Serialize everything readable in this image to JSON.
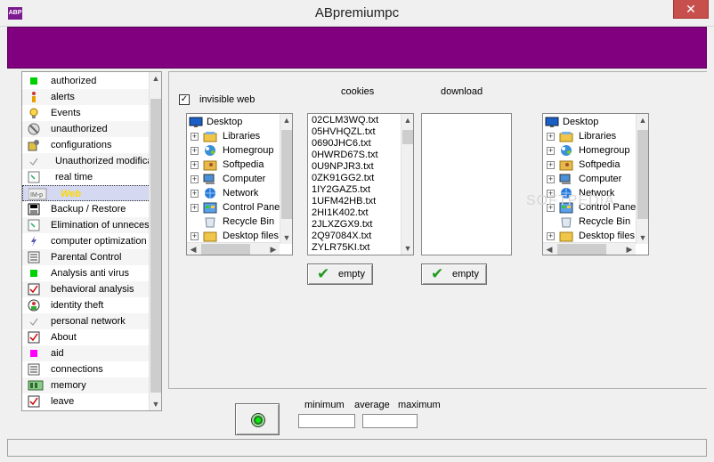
{
  "window": {
    "title": "ABpremiumpc",
    "app_icon_text": "ABP",
    "close_glyph": "✕"
  },
  "sidebar": {
    "items": [
      {
        "label": "authorized",
        "icon": "green-square-icon"
      },
      {
        "label": "alerts",
        "icon": "person-alert-icon"
      },
      {
        "label": "Events",
        "icon": "lightbulb-icon"
      },
      {
        "label": "unauthorized",
        "icon": "no-sign-icon"
      },
      {
        "label": "configurations",
        "icon": "config-icon"
      },
      {
        "label": "Unauthorized modifica",
        "icon": "small-check-icon"
      },
      {
        "label": "real time",
        "icon": "arrow-icon"
      },
      {
        "label": "Web",
        "icon": "web-icon",
        "icon_text": "IM-p"
      },
      {
        "label": "Backup / Restore",
        "icon": "backup-icon"
      },
      {
        "label": "Elimination of unneces",
        "icon": "arrow-icon"
      },
      {
        "label": "computer optimization",
        "icon": "lightning-icon"
      },
      {
        "label": "Parental Control",
        "icon": "list-icon"
      },
      {
        "label": "Analysis anti virus",
        "icon": "green-square-icon"
      },
      {
        "label": "behavioral analysis",
        "icon": "checkbox-icon"
      },
      {
        "label": "identity theft",
        "icon": "identity-icon"
      },
      {
        "label": "personal network",
        "icon": "small-check-icon"
      },
      {
        "label": "About",
        "icon": "checkbox-icon"
      },
      {
        "label": "aid",
        "icon": "magenta-square-icon"
      },
      {
        "label": "connections",
        "icon": "list-icon"
      },
      {
        "label": "memory",
        "icon": "memory-icon"
      },
      {
        "label": "leave",
        "icon": "checkbox-icon"
      }
    ]
  },
  "web_panel": {
    "invisible_web_label": "invisible web",
    "invisible_web_checked": true,
    "cookies_header": "cookies",
    "download_header": "download",
    "left_tree": [
      {
        "label": "Desktop",
        "icon": "desktop-icon",
        "expandable": false
      },
      {
        "label": "Libraries",
        "icon": "libraries-icon",
        "expandable": true
      },
      {
        "label": "Homegroup",
        "icon": "homegroup-icon",
        "expandable": true
      },
      {
        "label": "Softpedia",
        "icon": "user-folder-icon",
        "expandable": true
      },
      {
        "label": "Computer",
        "icon": "computer-icon",
        "expandable": true
      },
      {
        "label": "Network",
        "icon": "network-icon",
        "expandable": true
      },
      {
        "label": "Control Pane",
        "icon": "control-panel-icon",
        "expandable": true
      },
      {
        "label": "Recycle Bin",
        "icon": "recycle-bin-icon",
        "expandable": false
      },
      {
        "label": "Desktop files",
        "icon": "folder-icon",
        "expandable": true
      }
    ],
    "right_tree": [
      {
        "label": "Desktop",
        "icon": "desktop-icon",
        "expandable": false
      },
      {
        "label": "Libraries",
        "icon": "libraries-icon",
        "expandable": true
      },
      {
        "label": "Homegroup",
        "icon": "homegroup-icon",
        "expandable": true
      },
      {
        "label": "Softpedia",
        "icon": "user-folder-icon",
        "expandable": true
      },
      {
        "label": "Computer",
        "icon": "computer-icon",
        "expandable": true
      },
      {
        "label": "Network",
        "icon": "network-icon",
        "expandable": true
      },
      {
        "label": "Control Pane",
        "icon": "control-panel-icon",
        "expandable": true
      },
      {
        "label": "Recycle Bin",
        "icon": "recycle-bin-icon",
        "expandable": false
      },
      {
        "label": "Desktop files",
        "icon": "folder-icon",
        "expandable": true
      }
    ],
    "cookies": [
      "02CLM3WQ.txt",
      "05HVHQZL.txt",
      "0690JHC6.txt",
      "0HWRD67S.txt",
      "0U9NPJR3.txt",
      "0ZK91GG2.txt",
      "1IY2GAZ5.txt",
      "1UFM42HB.txt",
      "2HI1K402.txt",
      "2JLXZGX9.txt",
      "2Q97084X.txt",
      "ZYLR75KI.txt"
    ],
    "downloads": [],
    "empty_cookies_label": "empty",
    "empty_download_label": "empty"
  },
  "stats": {
    "minimum_label": "minimum",
    "average_label": "average",
    "maximum_label": "maximum",
    "minimum_value": "",
    "average_value": ""
  },
  "watermark": "SOFTPEDIA",
  "colors": {
    "band": "#800080",
    "accent_selected_text": "#ffd700",
    "ok_green": "#1e9a1e"
  }
}
